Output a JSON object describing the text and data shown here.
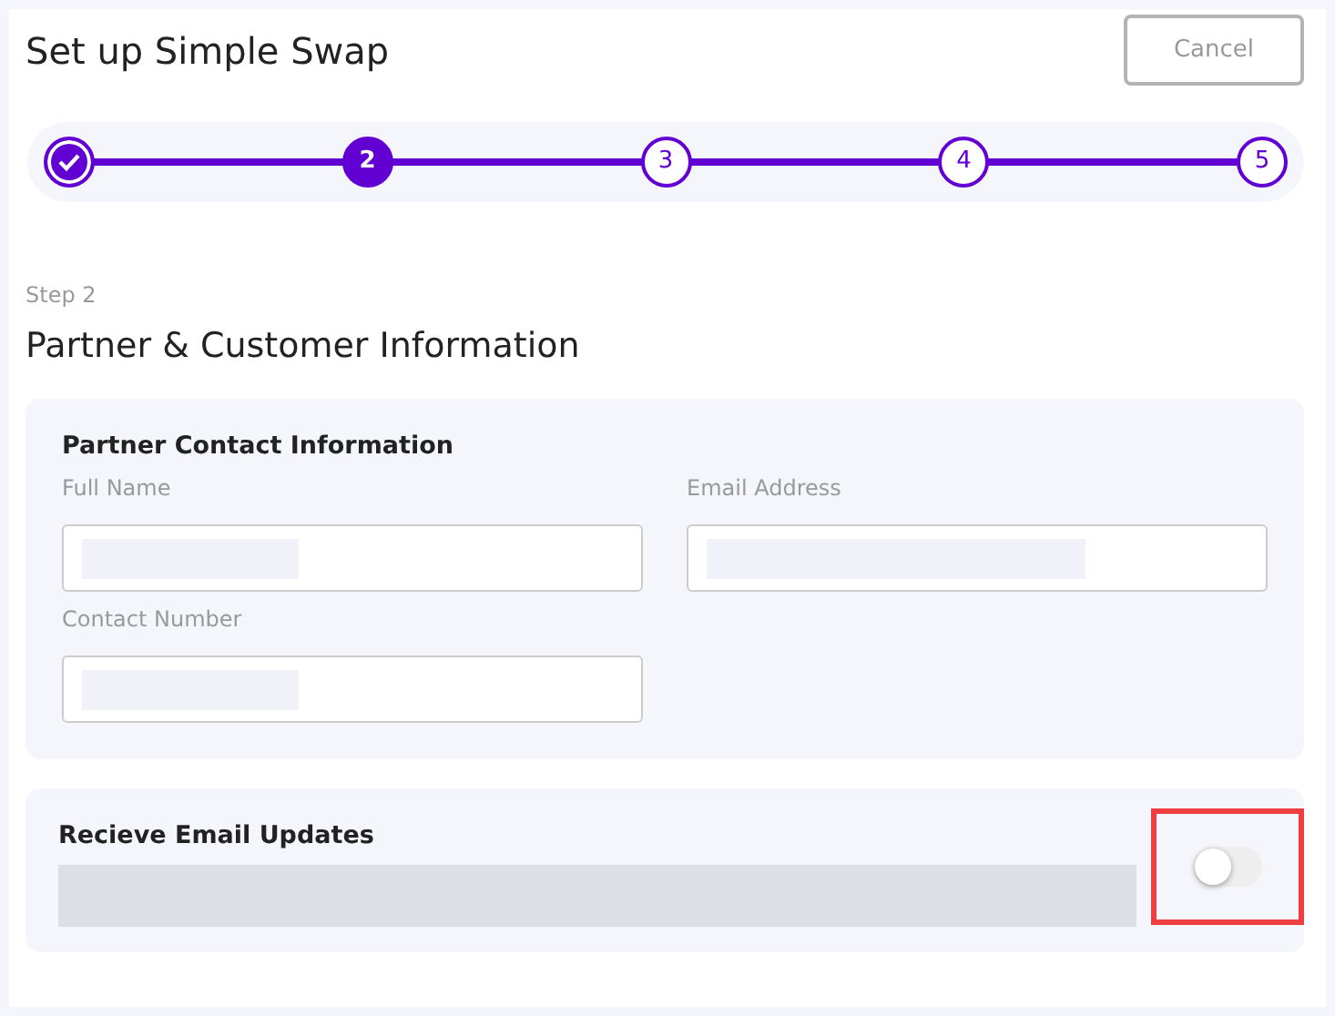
{
  "title": "Set up Simple Swap",
  "cancel_button": "Cancel",
  "stepper": {
    "steps": [
      {
        "completed": true,
        "selected": false
      },
      {
        "label": "2",
        "completed": false,
        "selected": true
      },
      {
        "label": "3",
        "completed": false,
        "selected": false
      },
      {
        "label": "4",
        "completed": false,
        "selected": false
      },
      {
        "label": "5",
        "completed": false,
        "selected": false
      }
    ]
  },
  "step_label": "Step 2",
  "heading": "Partner & Customer Information",
  "contact_card": {
    "title": "Partner Contact Information",
    "fields": [
      {
        "label": "Full Name"
      },
      {
        "label": "Email Address"
      },
      {
        "label": "Contact Number"
      }
    ]
  },
  "updates_card": {
    "title": "Recieve Email Updates",
    "toggle": {
      "on": false,
      "highlighted": true
    }
  }
}
